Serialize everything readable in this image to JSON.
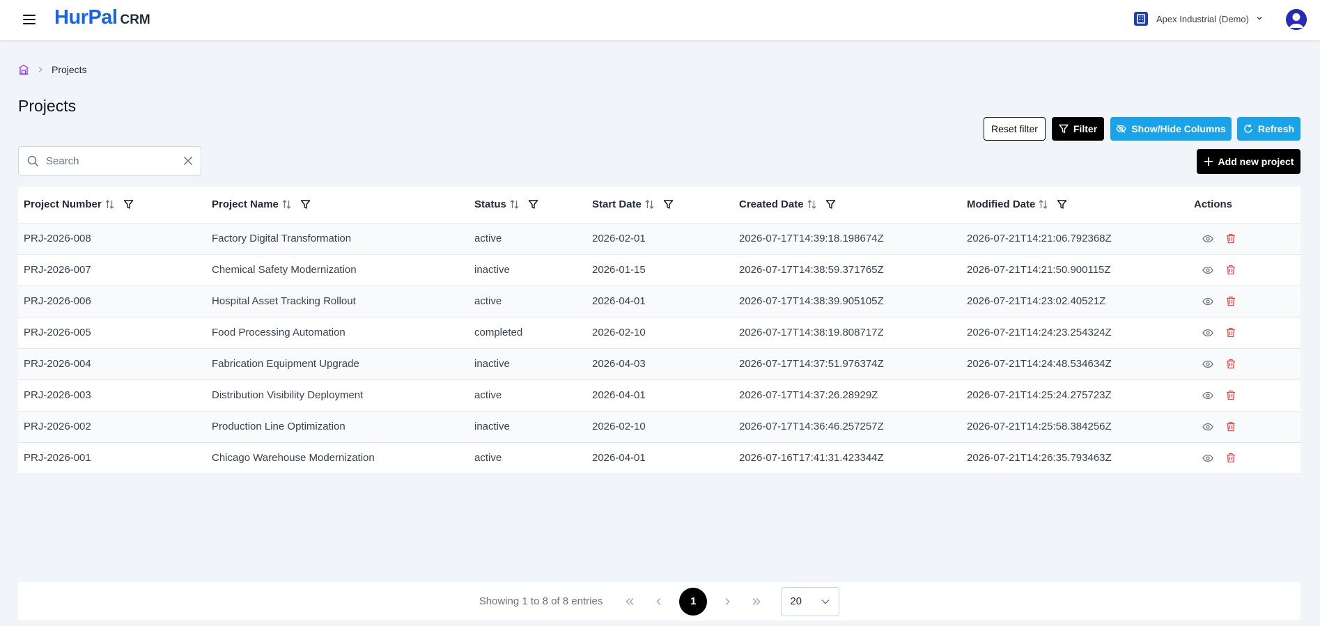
{
  "header": {
    "brand_main": "HurPal",
    "brand_sub": "CRM",
    "company": "Apex Industrial (Demo)"
  },
  "breadcrumb": {
    "current": "Projects"
  },
  "page": {
    "title": "Projects"
  },
  "toolbar": {
    "reset_label": "Reset filter",
    "filter_label": "Filter",
    "columns_label": "Show/Hide Columns",
    "refresh_label": "Refresh",
    "add_label": "Add new project"
  },
  "search": {
    "placeholder": "Search",
    "value": ""
  },
  "table": {
    "columns": [
      "Project Number",
      "Project Name",
      "Status",
      "Start Date",
      "Created Date",
      "Modified Date",
      "Actions"
    ],
    "rows": [
      [
        "PRJ-2026-008",
        "Factory Digital Transformation",
        "active",
        "2026-02-01",
        "2026-07-17T14:39:18.198674Z",
        "2026-07-21T14:21:06.792368Z"
      ],
      [
        "PRJ-2026-007",
        "Chemical Safety Modernization",
        "inactive",
        "2026-01-15",
        "2026-07-17T14:38:59.371765Z",
        "2026-07-21T14:21:50.900115Z"
      ],
      [
        "PRJ-2026-006",
        "Hospital Asset Tracking Rollout",
        "active",
        "2026-04-01",
        "2026-07-17T14:38:39.905105Z",
        "2026-07-21T14:23:02.40521Z"
      ],
      [
        "PRJ-2026-005",
        "Food Processing Automation",
        "completed",
        "2026-02-10",
        "2026-07-17T14:38:19.808717Z",
        "2026-07-21T14:24:23.254324Z"
      ],
      [
        "PRJ-2026-004",
        "Fabrication Equipment Upgrade",
        "inactive",
        "2026-04-03",
        "2026-07-17T14:37:51.976374Z",
        "2026-07-21T14:24:48.534634Z"
      ],
      [
        "PRJ-2026-003",
        "Distribution Visibility Deployment",
        "active",
        "2026-04-01",
        "2026-07-17T14:37:26.28929Z",
        "2026-07-21T14:25:24.275723Z"
      ],
      [
        "PRJ-2026-002",
        "Production Line Optimization",
        "inactive",
        "2026-02-10",
        "2026-07-17T14:36:46.257257Z",
        "2026-07-21T14:25:58.384256Z"
      ],
      [
        "PRJ-2026-001",
        "Chicago Warehouse Modernization",
        "active",
        "2026-04-01",
        "2026-07-16T17:41:31.423344Z",
        "2026-07-21T14:26:35.793463Z"
      ]
    ]
  },
  "pagination": {
    "info": "Showing 1 to 8 of 8 entries",
    "current_page": "1",
    "per_page": "20"
  },
  "colors": {
    "brand": "#1565e8",
    "primary_dark": "#000000",
    "info": "#1aa3e8",
    "danger": "#ef4444",
    "accent_home": "#9333ea"
  },
  "icons": {
    "menu": "hamburger-icon",
    "home": "home-icon",
    "chevron": "chevron-right-icon",
    "sort": "sort-icon",
    "filter": "filter-icon",
    "view": "eye-icon",
    "delete": "trash-icon"
  }
}
